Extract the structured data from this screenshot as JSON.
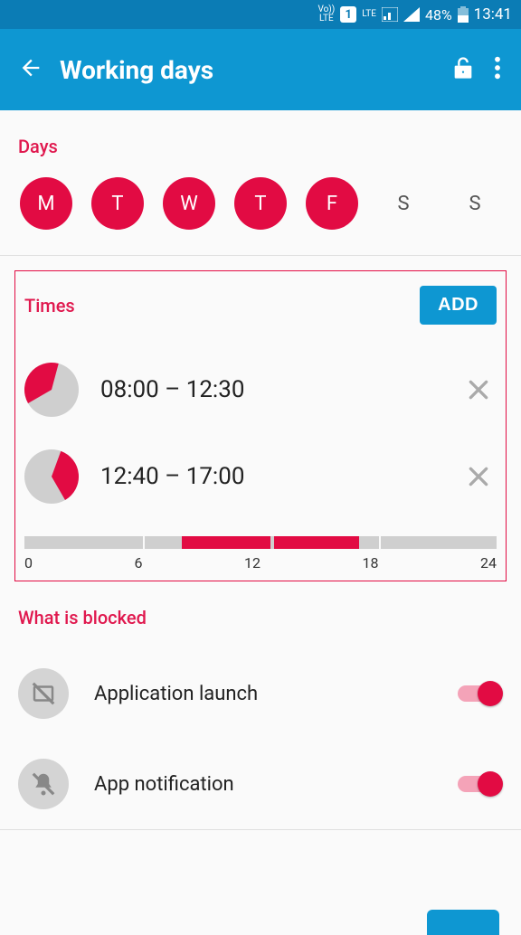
{
  "status": {
    "battery_pct": "48%",
    "time": "13:41",
    "sim_label": "1",
    "volte": "Vo))\nLTE",
    "lte": "LTE"
  },
  "header": {
    "title": "Working days"
  },
  "days": {
    "section_label": "Days",
    "items": [
      {
        "label": "M",
        "selected": true
      },
      {
        "label": "T",
        "selected": true
      },
      {
        "label": "W",
        "selected": true
      },
      {
        "label": "T",
        "selected": true
      },
      {
        "label": "F",
        "selected": true
      },
      {
        "label": "S",
        "selected": false
      },
      {
        "label": "S",
        "selected": false
      }
    ]
  },
  "times": {
    "section_label": "Times",
    "add_label": "ADD",
    "entries": [
      {
        "label": "08:00 – 12:30",
        "start_h": 8.0,
        "end_h": 12.5
      },
      {
        "label": "12:40 – 17:00",
        "start_h": 12.67,
        "end_h": 17.0
      }
    ],
    "timeline_ticks": [
      "0",
      "6",
      "12",
      "18",
      "24"
    ]
  },
  "blocked": {
    "section_label": "What is blocked",
    "items": [
      {
        "label": "Application launch",
        "enabled": true
      },
      {
        "label": "App notification",
        "enabled": true
      }
    ]
  },
  "colors": {
    "accent": "#e20b43",
    "primary": "#0e97d2"
  }
}
